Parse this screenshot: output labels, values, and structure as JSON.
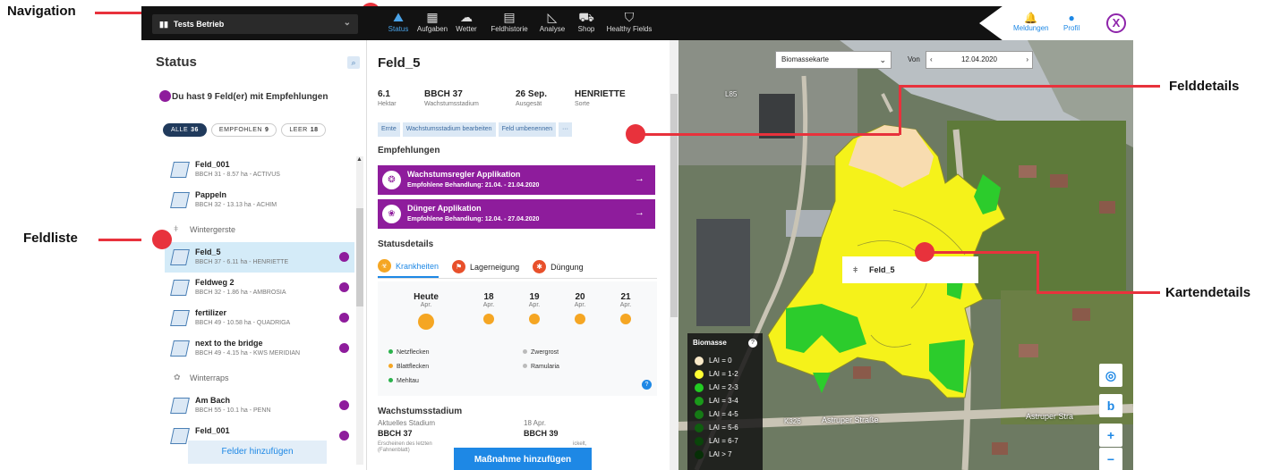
{
  "annotations": {
    "navigation": "Navigation",
    "feldliste": "Feldliste",
    "felddetails": "Felddetails",
    "kartendetails": "Kartendetails"
  },
  "topbar": {
    "farm": "Tests Betrieb",
    "nav": [
      {
        "label": "Status",
        "icon": "status-icon",
        "active": true
      },
      {
        "label": "Aufgaben",
        "icon": "calendar-icon"
      },
      {
        "label": "Wetter",
        "icon": "weather-icon"
      },
      {
        "label": "Feldhistorie",
        "icon": "history-icon"
      },
      {
        "label": "Analyse",
        "icon": "chart-icon"
      },
      {
        "label": "Shop",
        "icon": "cart-icon"
      },
      {
        "label": "Healthy Fields",
        "icon": "shield-icon"
      }
    ],
    "notifications": "Meldungen",
    "profile": "Profil",
    "close": "X"
  },
  "left": {
    "title": "Status",
    "recommendation": "Du hast 9 Feld(er) mit Empfehlungen",
    "filters": [
      {
        "label": "ALLE",
        "count": "36"
      },
      {
        "label": "EMPFOHLEN",
        "count": "9"
      },
      {
        "label": "LEER",
        "count": "18"
      }
    ],
    "fields_a": [
      {
        "name": "Feld_001",
        "sub": "BBCH 31 - 8.57 ha - ACTIVUS"
      },
      {
        "name": "Pappeln",
        "sub": "BBCH 32 - 13.13 ha - ACHIM"
      }
    ],
    "group1": "Wintergerste",
    "fields_b": [
      {
        "name": "Feld_5",
        "sub": "BBCH 37 - 6.11 ha - HENRIETTE"
      },
      {
        "name": "Feldweg 2",
        "sub": "BBCH 32 - 1.86 ha - AMBROSIA"
      },
      {
        "name": "fertilizer",
        "sub": "BBCH 49 - 10.58 ha - QUADRIGA"
      },
      {
        "name": "next to the bridge",
        "sub": "BBCH 49 - 4.15 ha - KWS MERIDIAN"
      }
    ],
    "group2": "Winterraps",
    "fields_c": [
      {
        "name": "Am Bach",
        "sub": "BBCH 55 - 10.1 ha - PENN"
      },
      {
        "name": "Feld_001",
        "sub": ""
      }
    ],
    "add_fields": "Felder hinzufügen"
  },
  "mid": {
    "title": "Feld_5",
    "stats": [
      {
        "v": "6.1",
        "l": "Hektar"
      },
      {
        "v": "BBCH 37",
        "l": "Wachstumsstadium"
      },
      {
        "v": "26 Sep.",
        "l": "Ausgesät"
      },
      {
        "v": "HENRIETTE",
        "l": "Sorte"
      }
    ],
    "chips": [
      "Ernte",
      "Wachstumsstadium bearbeiten",
      "Feld umbenennen",
      "···"
    ],
    "empfehlungen": "Empfehlungen",
    "recos": [
      {
        "title": "Wachstumsregler Applikation",
        "sub": "Empfohlene Behandlung: 21.04. - 21.04.2020"
      },
      {
        "title": "Dünger Applikation",
        "sub": "Empfohlene Behandlung: 12.04. - 27.04.2020"
      }
    ],
    "statusdetails": "Statusdetails",
    "tabs": [
      "Krankheiten",
      "Lagerneigung",
      "Düngung"
    ],
    "days": [
      {
        "d": "Heute",
        "m": "Apr."
      },
      {
        "d": "18",
        "m": "Apr."
      },
      {
        "d": "19",
        "m": "Apr."
      },
      {
        "d": "20",
        "m": "Apr."
      },
      {
        "d": "21",
        "m": "Apr."
      }
    ],
    "legend": [
      "Netzflecken",
      "Blattflecken",
      "Mehltau",
      "Zwergrost",
      "Ramularia"
    ],
    "legend_colors": [
      "#2bb24c",
      "#f5a623",
      "#2bb24c",
      "#bbbbbb",
      "#bbbbbb"
    ],
    "help": "?",
    "wachstum": "Wachstumsstadium",
    "current_label": "Aktuelles Stadium",
    "current_value": "BBCH 37",
    "current_desc": "Erscheinen des letzten",
    "current_desc2": "(Fahnenblatt)",
    "next_label": "18 Apr.",
    "next_value": "BBCH 39",
    "next_desc": "ickelt,",
    "action": "Maßnahme hinzufügen"
  },
  "map": {
    "layer": "Biomassekarte",
    "von": "Von",
    "date": "12.04.2020",
    "tooltip": "Feld_5",
    "legend_title": "Biomasse",
    "lai": [
      {
        "label": "LAI = 0",
        "color": "#f8e9c8"
      },
      {
        "label": "LAI = 1-2",
        "color": "#ffff33"
      },
      {
        "label": "LAI = 2-3",
        "color": "#22cc22"
      },
      {
        "label": "LAI = 3-4",
        "color": "#1a9a1a"
      },
      {
        "label": "LAI = 4-5",
        "color": "#157a15"
      },
      {
        "label": "LAI = 5-6",
        "color": "#0f5e0f"
      },
      {
        "label": "LAI = 6-7",
        "color": "#0a450a"
      },
      {
        "label": "LAI > 7",
        "color": "#062f06"
      }
    ],
    "roads": [
      "L85",
      "K326",
      "Astruper Straße",
      "Astruper Stra"
    ],
    "controls": [
      "◎",
      "b",
      "+",
      "−"
    ]
  }
}
